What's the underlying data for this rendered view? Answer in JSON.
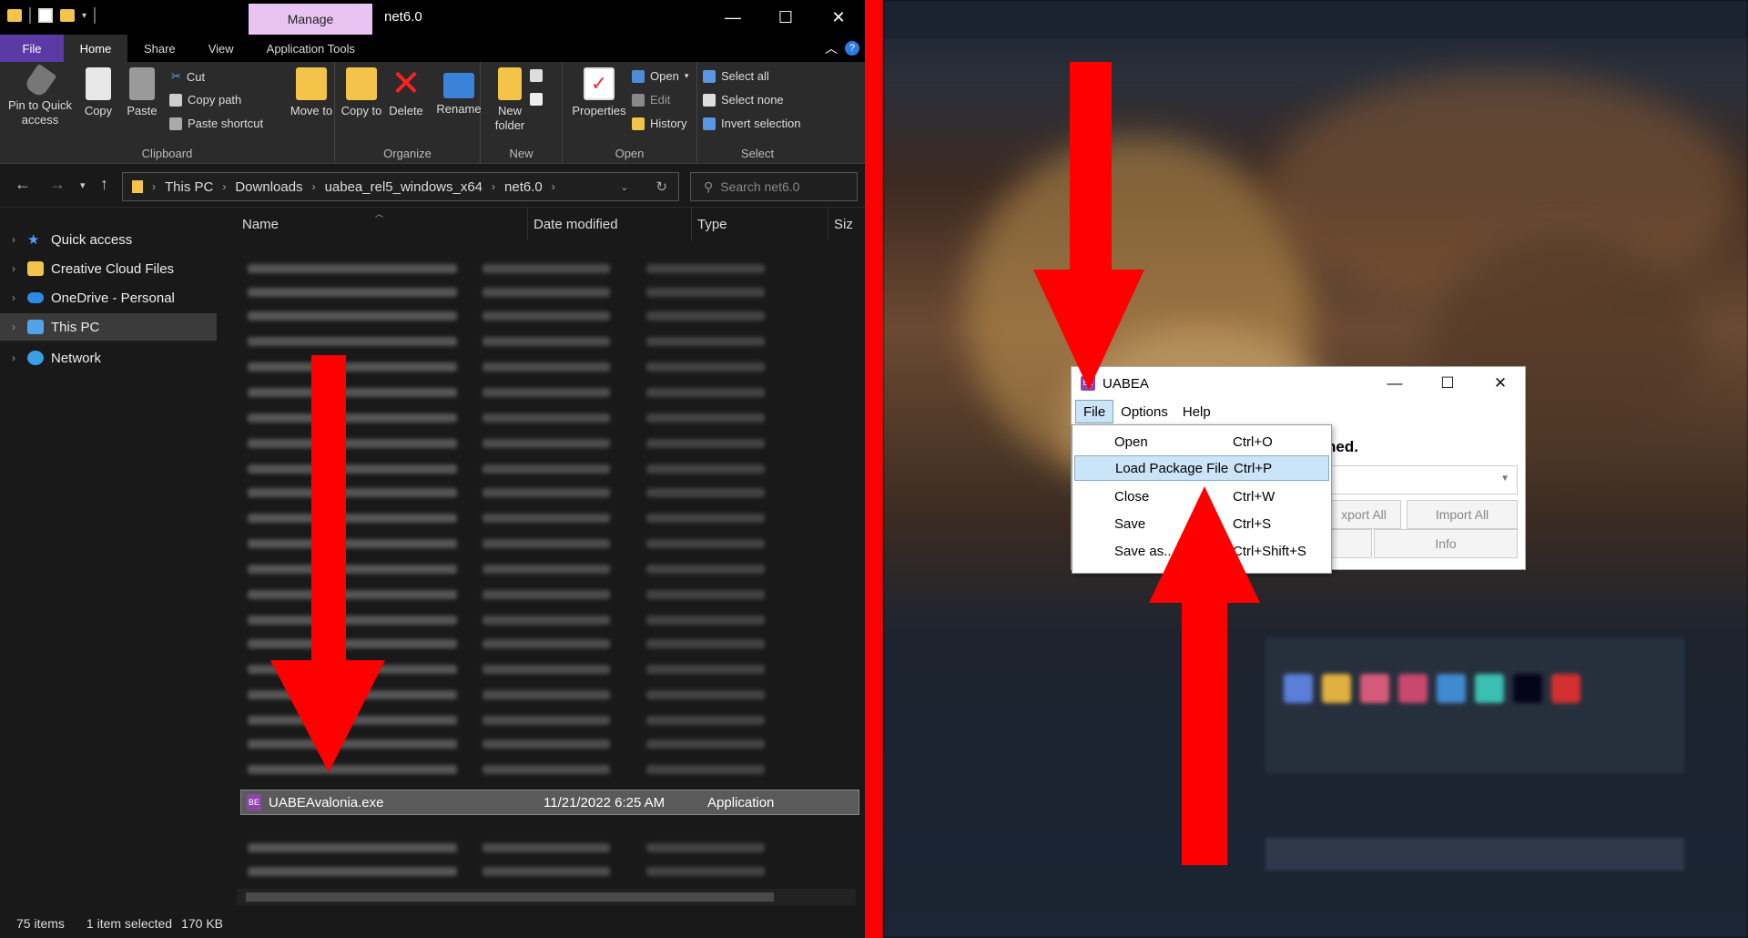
{
  "explorer": {
    "manage_tab": "Manage",
    "window_title": "net6.0",
    "tabs": [
      "File",
      "Home",
      "Share",
      "View",
      "Application Tools"
    ],
    "ribbon": {
      "clipboard": {
        "pin": "Pin to Quick access",
        "copy": "Copy",
        "paste": "Paste",
        "cut": "Cut",
        "copy_path": "Copy path",
        "paste_shortcut": "Paste shortcut",
        "label": "Clipboard"
      },
      "organize": {
        "move_to": "Move to",
        "copy_to": "Copy to",
        "delete": "Delete",
        "rename": "Rename",
        "label": "Organize"
      },
      "new": {
        "new_folder": "New folder",
        "label": "New"
      },
      "open": {
        "properties": "Properties",
        "open": "Open",
        "edit": "Edit",
        "history": "History",
        "label": "Open"
      },
      "select": {
        "select_all": "Select all",
        "select_none": "Select none",
        "invert": "Invert selection",
        "label": "Select"
      }
    },
    "breadcrumb": [
      "This PC",
      "Downloads",
      "uabea_rel5_windows_x64",
      "net6.0"
    ],
    "search_placeholder": "Search net6.0",
    "nav": [
      "Quick access",
      "Creative Cloud Files",
      "OneDrive - Personal",
      "This PC",
      "Network"
    ],
    "columns": [
      "Name",
      "Date modified",
      "Type",
      "Siz"
    ],
    "selected_file": {
      "name": "UABEAvalonia.exe",
      "date": "11/21/2022 6:25 AM",
      "type": "Application"
    },
    "status": {
      "items": "75 items",
      "selected": "1 item selected",
      "size": "170 KB"
    }
  },
  "uabea": {
    "title": "UABEA",
    "menu": [
      "File",
      "Options",
      "Help"
    ],
    "body_text": "ned.",
    "buttons": [
      "xport All",
      "Import All",
      "Info"
    ],
    "file_menu": [
      {
        "label": "Open",
        "shortcut": "Ctrl+O"
      },
      {
        "label": "Load Package File",
        "shortcut": "Ctrl+P"
      },
      {
        "label": "Close",
        "shortcut": "Ctrl+W"
      },
      {
        "label": "Save",
        "shortcut": "Ctrl+S"
      },
      {
        "label": "Save as...",
        "shortcut": "Ctrl+Shift+S"
      }
    ]
  },
  "colors": {
    "arrow": "#ff0000",
    "file_tab": "#5b3aa6",
    "manage_tab": "#e9c4f3",
    "menu_highlight": "#cce4f7"
  }
}
